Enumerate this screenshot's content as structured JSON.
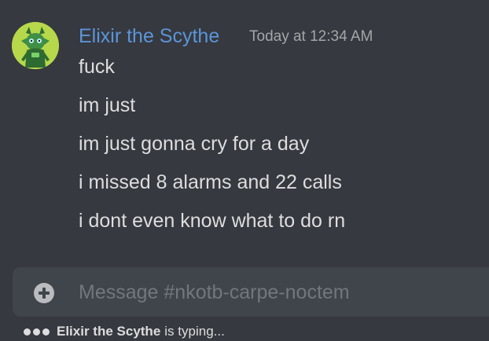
{
  "author": {
    "name": "Elixir the Scythe",
    "name_color": "#5b95d9",
    "avatar_icon": "green-creature-avatar"
  },
  "timestamp": "Today at 12:34 AM",
  "messages": [
    "fuck",
    "im just",
    "im just gonna cry for a day",
    "i missed 8 alarms and 22 calls",
    "i dont even know what to do rn"
  ],
  "composer": {
    "attach_icon": "plus-circle-icon",
    "placeholder": "Message #nkotb-carpe-noctem"
  },
  "typing": {
    "name": "Elixir the Scythe",
    "suffix": "is typing..."
  },
  "colors": {
    "background": "#36393f",
    "input_background": "#40444b",
    "text": "#dcddde",
    "muted": "#a3a6aa"
  }
}
